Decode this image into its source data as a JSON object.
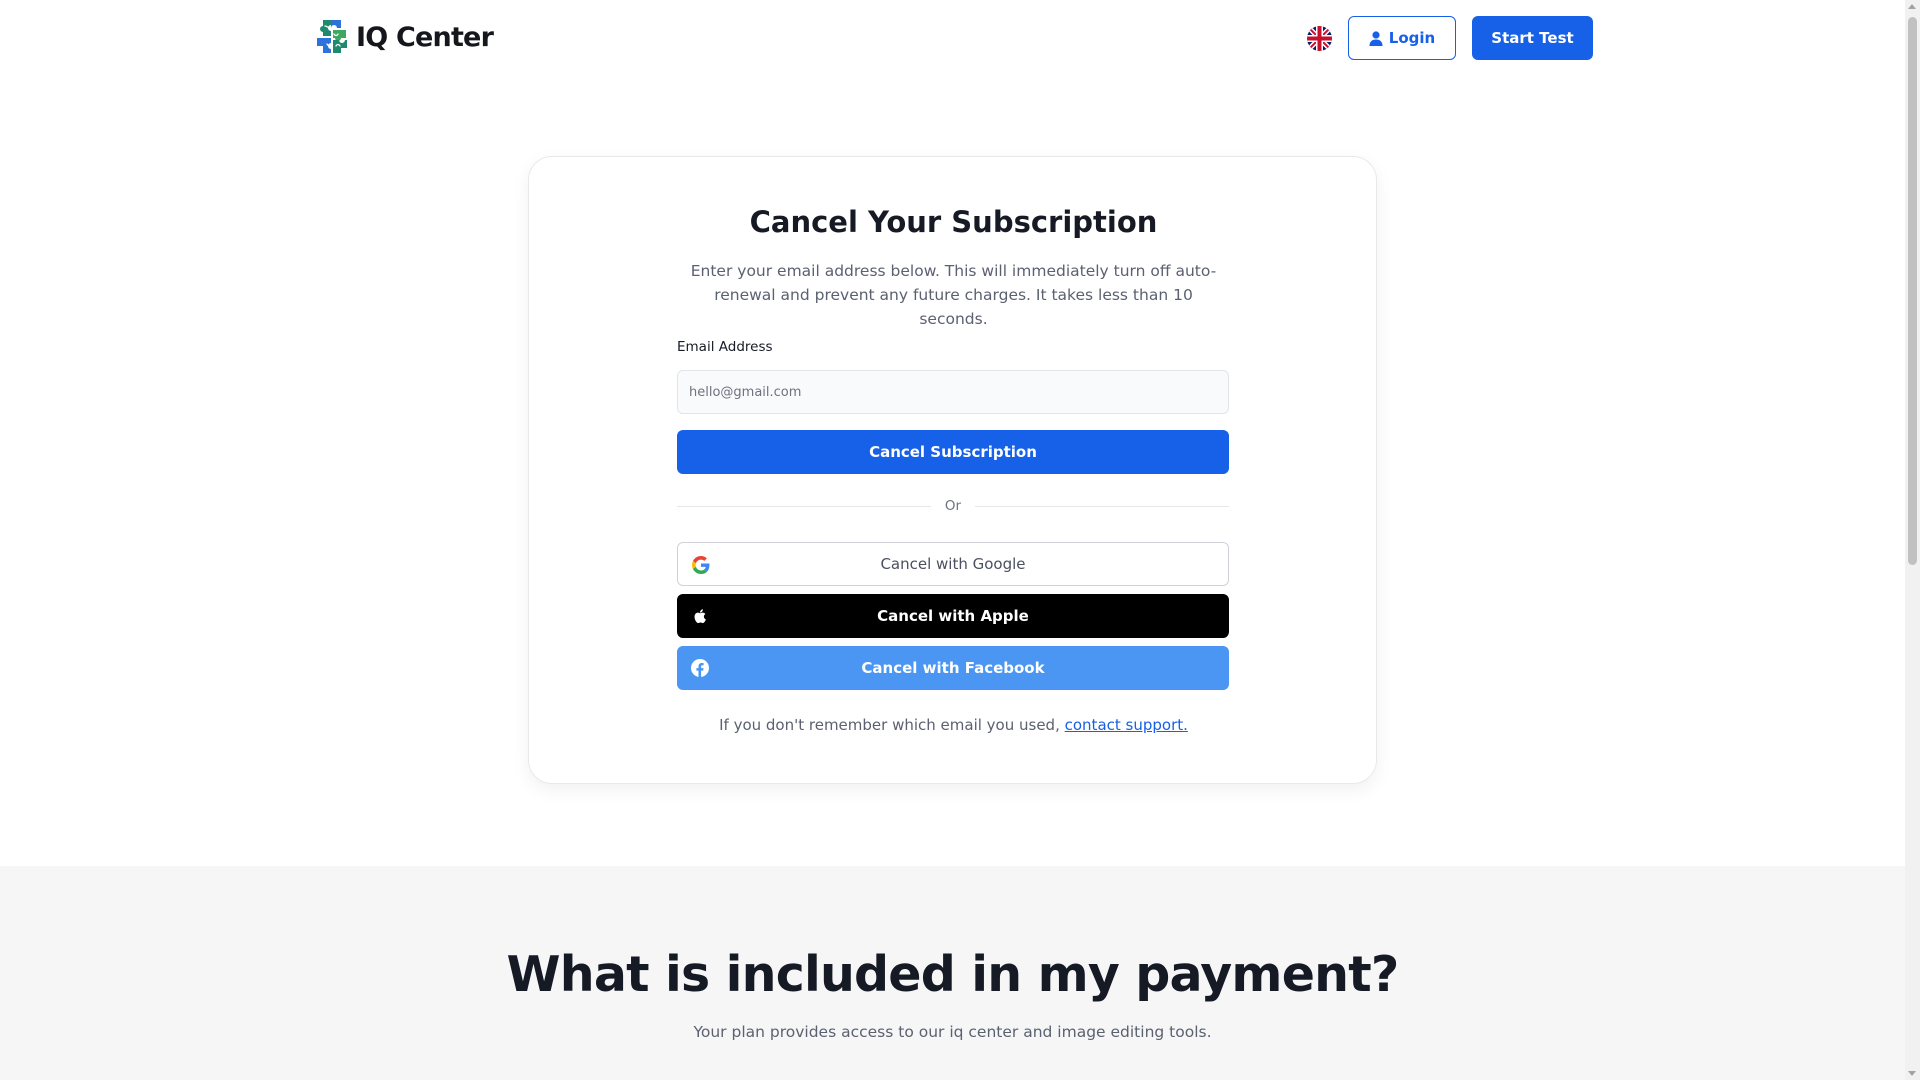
{
  "header": {
    "brand": "IQ Center",
    "language": "flag-uk-icon",
    "login_label": "Login",
    "start_label": "Start Test"
  },
  "card": {
    "title": "Cancel Your Subscription",
    "description": "Enter your email address below. This will immediately turn off auto-renewal and prevent any future charges. It takes less than 10 seconds.",
    "email_label": "Email Address",
    "email_placeholder": "hello@gmail.com",
    "email_value": "",
    "cancel_button": "Cancel Subscription",
    "divider_text": "Or",
    "google_button": "Cancel with Google",
    "apple_button": "Cancel with Apple",
    "facebook_button": "Cancel with Facebook",
    "support_text": "If you don't remember which email you used, ",
    "support_link": "contact support."
  },
  "faq": {
    "title": "What is included in my payment?",
    "subtitle": "Your plan provides access to our iq center and image editing tools."
  },
  "colors": {
    "primary": "#1760e8",
    "facebook": "#4a96f2",
    "apple": "#000000",
    "section_bg": "#f6f6f7"
  }
}
